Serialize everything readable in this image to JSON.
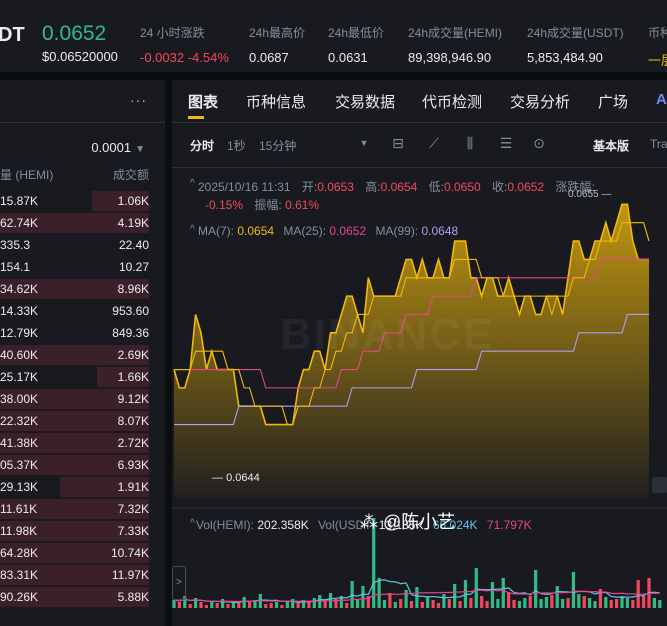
{
  "header": {
    "pair_fragment": "DT",
    "price": "0.0652",
    "price_usd": "$0.06520000",
    "stats": [
      {
        "label": "24 小时涨跌",
        "value": "-0.0032 -4.54%",
        "tone": "red"
      },
      {
        "label": "24h最高价",
        "value": "0.0687",
        "tone": ""
      },
      {
        "label": "24h最低价",
        "value": "0.0631",
        "tone": ""
      },
      {
        "label": "24h成交量(HEMI)",
        "value": "89,398,946.90",
        "tone": ""
      },
      {
        "label": "24h成交量(USDT)",
        "value": "5,853,484.90",
        "tone": ""
      },
      {
        "label": "币种",
        "value": "一层",
        "tone": "gold"
      }
    ]
  },
  "book": {
    "more_icon": "more-dots-icon",
    "precision": "0.0001",
    "col_amount": "量 (HEMI)",
    "col_total": "成交额",
    "rows": [
      {
        "amount": "15.87K",
        "total": "1.06K",
        "depth": 0.38
      },
      {
        "amount": "62.74K",
        "total": "4.19K",
        "depth": 1.0
      },
      {
        "amount": "335.3",
        "total": "22.40",
        "depth": 0.0
      },
      {
        "amount": "154.1",
        "total": "10.27",
        "depth": 0.0
      },
      {
        "amount": "34.62K",
        "total": "8.96K",
        "depth": 1.0
      },
      {
        "amount": "14.33K",
        "total": "953.60",
        "depth": 0.0
      },
      {
        "amount": "12.79K",
        "total": "849.36",
        "depth": 0.0
      },
      {
        "amount": "40.60K",
        "total": "2.69K",
        "depth": 1.0
      },
      {
        "amount": "25.17K",
        "total": "1.66K",
        "depth": 0.35
      },
      {
        "amount": "38.00K",
        "total": "9.12K",
        "depth": 1.0
      },
      {
        "amount": "22.32K",
        "total": "8.07K",
        "depth": 1.0
      },
      {
        "amount": "41.38K",
        "total": "2.72K",
        "depth": 1.0
      },
      {
        "amount": "05.37K",
        "total": "6.93K",
        "depth": 1.0
      },
      {
        "amount": "29.13K",
        "total": "1.91K",
        "depth": 0.6
      },
      {
        "amount": "11.61K",
        "total": "7.32K",
        "depth": 1.0
      },
      {
        "amount": "11.98K",
        "total": "7.33K",
        "depth": 1.0
      },
      {
        "amount": "64.28K",
        "total": "10.74K",
        "depth": 1.0
      },
      {
        "amount": "83.31K",
        "total": "11.97K",
        "depth": 1.0
      },
      {
        "amount": "90.26K",
        "total": "5.88K",
        "depth": 1.0
      }
    ]
  },
  "panel": {
    "tabs": [
      "图表",
      "币种信息",
      "交易数据",
      "代币检测",
      "交易分析",
      "广场"
    ],
    "tab_more": "A",
    "intervals": [
      "分时",
      "1秒",
      "15分钟"
    ],
    "version": "基本版",
    "version_more": "Tra",
    "tool_icons": [
      "dropdown-icon",
      "indicator-icon",
      "draw-icon",
      "candle-type-icon",
      "settings-icon",
      "target-icon"
    ]
  },
  "ohlc": {
    "datetime": "2025/10/16 11:31",
    "open_label": "开:",
    "open": "0.0653",
    "high_label": "高:",
    "high": "0.0654",
    "low_label": "低:",
    "low": "0.0650",
    "close_label": "收:",
    "close": "0.0652",
    "change_label": "涨跌幅:",
    "change": "-0.15%",
    "amp_label": "振幅:",
    "amp": "0.61%"
  },
  "ma": {
    "ma7_label": "MA(7):",
    "ma7": "0.0654",
    "ma25_label": "MA(25):",
    "ma25": "0.0652",
    "ma99_label": "MA(99):",
    "ma99": "0.0648"
  },
  "volume": {
    "hemi_label": "Vol(HEMI):",
    "hemi": "202.358K",
    "usdt_label": "Vol(USDT)",
    "usdt": "13.185K",
    "ma_a": "66.024K",
    "ma_b": "71.797K"
  },
  "marks": {
    "high": "0.0655",
    "low": "0.0644"
  },
  "watermark_text": "BINANCE",
  "user_watermark": "⁂ @陈小艺",
  "colors": {
    "up": "#2ebd85",
    "down": "#f6465d",
    "gold": "#f0b90b",
    "ma25": "#e5468b",
    "ma99": "#b49af0"
  },
  "chart_data": {
    "type": "area",
    "y_range": [
      0.064,
      0.0657
    ],
    "price": [
      0.0647,
      0.0646,
      0.0646,
      0.0647,
      0.065,
      0.0649,
      0.0647,
      0.0648,
      0.0647,
      0.0647,
      0.0647,
      0.0647,
      0.0645,
      0.0645,
      0.0645,
      0.0645,
      0.0645,
      0.0644,
      0.0644,
      0.0644,
      0.0644,
      0.0644,
      0.0644,
      0.0646,
      0.0647,
      0.0647,
      0.0648,
      0.0648,
      0.0647,
      0.0649,
      0.0649,
      0.065,
      0.0651,
      0.0651,
      0.065,
      0.0649,
      0.0652,
      0.0651,
      0.0651,
      0.0651,
      0.0651,
      0.0651,
      0.0652,
      0.0653,
      0.0653,
      0.0652,
      0.0653,
      0.0652,
      0.0652,
      0.0653,
      0.0652,
      0.0652,
      0.0654,
      0.0654,
      0.0654,
      0.0652,
      0.0652,
      0.0651,
      0.0652,
      0.0652,
      0.0651,
      0.0651,
      0.0652,
      0.0651,
      0.065,
      0.0651,
      0.0651,
      0.065,
      0.065,
      0.0651,
      0.0651,
      0.0651,
      0.065,
      0.0652,
      0.0654,
      0.0654,
      0.0653,
      0.0653,
      0.0654,
      0.0654,
      0.0655,
      0.0654,
      0.0655,
      0.0656,
      0.0656,
      0.0654,
      0.0653,
      0.0653,
      0.0653
    ],
    "ma7": [
      0.0647,
      0.0647,
      0.0647,
      0.0647,
      0.0648,
      0.0648,
      0.0648,
      0.0648,
      0.0648,
      0.0648,
      0.0647,
      0.0647,
      0.0647,
      0.0646,
      0.0646,
      0.0645,
      0.0645,
      0.0645,
      0.0645,
      0.0645,
      0.0645,
      0.0644,
      0.0644,
      0.0645,
      0.0645,
      0.0645,
      0.0646,
      0.0646,
      0.0647,
      0.0647,
      0.0648,
      0.0648,
      0.0649,
      0.0649,
      0.065,
      0.065,
      0.065,
      0.0651,
      0.0651,
      0.0651,
      0.0651,
      0.0651,
      0.0651,
      0.0652,
      0.0652,
      0.0652,
      0.0652,
      0.0652,
      0.0652,
      0.0652,
      0.0652,
      0.0652,
      0.0653,
      0.0653,
      0.0653,
      0.0653,
      0.0653,
      0.0652,
      0.0652,
      0.0652,
      0.0652,
      0.0651,
      0.0651,
      0.0651,
      0.0651,
      0.0651,
      0.0651,
      0.0651,
      0.0651,
      0.0651,
      0.065,
      0.0651,
      0.0651,
      0.0651,
      0.0652,
      0.0652,
      0.0652,
      0.0653,
      0.0653,
      0.0654,
      0.0654,
      0.0654,
      0.0654,
      0.0655,
      0.0655,
      0.0655,
      0.0655,
      0.0655,
      0.0654
    ],
    "ma25": [
      0.0647,
      0.0647,
      0.0647,
      0.0647,
      0.0647,
      0.0647,
      0.0647,
      0.0647,
      0.0647,
      0.0647,
      0.0647,
      0.0647,
      0.0647,
      0.0647,
      0.0647,
      0.0647,
      0.0647,
      0.0646,
      0.0646,
      0.0646,
      0.0646,
      0.0646,
      0.0646,
      0.0646,
      0.0646,
      0.0646,
      0.0646,
      0.0646,
      0.0646,
      0.0646,
      0.0646,
      0.0647,
      0.0647,
      0.0647,
      0.0647,
      0.0648,
      0.0648,
      0.0648,
      0.0648,
      0.0649,
      0.0649,
      0.0649,
      0.0649,
      0.065,
      0.065,
      0.065,
      0.065,
      0.065,
      0.0651,
      0.0651,
      0.0651,
      0.0651,
      0.0651,
      0.0651,
      0.0651,
      0.0651,
      0.0652,
      0.0652,
      0.0652,
      0.0652,
      0.0652,
      0.0652,
      0.0652,
      0.0652,
      0.0652,
      0.0652,
      0.0652,
      0.0652,
      0.0652,
      0.0652,
      0.0652,
      0.0652,
      0.0652,
      0.0652,
      0.0652,
      0.0652,
      0.0652,
      0.0652,
      0.0652,
      0.0653,
      0.0653,
      0.0653,
      0.0653,
      0.0653,
      0.0653,
      0.0653,
      0.0653,
      0.0653,
      0.0653
    ],
    "ma99": [
      0.0644,
      0.0644,
      0.0644,
      0.0644,
      0.0644,
      0.0644,
      0.0644,
      0.0644,
      0.0644,
      0.0644,
      0.0644,
      0.0644,
      0.0645,
      0.0645,
      0.0645,
      0.0645,
      0.0645,
      0.0645,
      0.0645,
      0.0645,
      0.0645,
      0.0645,
      0.0645,
      0.0645,
      0.0645,
      0.0645,
      0.0645,
      0.0645,
      0.0645,
      0.0645,
      0.0645,
      0.0645,
      0.0645,
      0.0646,
      0.0646,
      0.0646,
      0.0646,
      0.0646,
      0.0646,
      0.0646,
      0.0646,
      0.0646,
      0.0646,
      0.0646,
      0.0646,
      0.0647,
      0.0647,
      0.0647,
      0.0647,
      0.0647,
      0.0647,
      0.0647,
      0.0647,
      0.0647,
      0.0647,
      0.0647,
      0.0647,
      0.0648,
      0.0648,
      0.0648,
      0.0648,
      0.0648,
      0.0648,
      0.0648,
      0.0648,
      0.0648,
      0.0648,
      0.0648,
      0.0648,
      0.0648,
      0.0648,
      0.0648,
      0.0648,
      0.0648,
      0.0648,
      0.0649,
      0.0649,
      0.0649,
      0.0649,
      0.0649,
      0.0649,
      0.0649,
      0.0649,
      0.0649,
      0.065,
      0.065,
      0.065,
      0.065,
      0.065
    ],
    "volume": [
      8,
      6,
      12,
      4,
      10,
      6,
      3,
      6,
      5,
      9,
      4,
      7,
      5,
      11,
      6,
      8,
      14,
      4,
      5,
      6,
      3,
      7,
      9,
      5,
      8,
      6,
      10,
      13,
      7,
      15,
      9,
      12,
      5,
      27,
      8,
      22,
      12,
      90,
      30,
      8,
      15,
      6,
      9,
      18,
      7,
      21,
      6,
      11,
      8,
      5,
      14,
      9,
      24,
      7,
      28,
      10,
      40,
      12,
      7,
      26,
      9,
      30,
      16,
      8,
      7,
      10,
      12,
      38,
      9,
      11,
      13,
      22,
      9,
      10,
      36,
      14,
      12,
      10,
      7,
      19,
      11,
      8,
      9,
      12,
      10,
      8,
      28,
      12,
      30,
      10,
      8
    ],
    "volume_up": [
      1,
      0,
      1,
      0,
      1,
      0,
      0,
      1,
      0,
      1,
      0,
      1,
      0,
      1,
      0,
      1,
      1,
      0,
      0,
      1,
      0,
      1,
      1,
      0,
      1,
      0,
      1,
      1,
      0,
      1,
      0,
      1,
      0,
      1,
      1,
      1,
      0,
      1,
      1,
      1,
      0,
      1,
      0,
      1,
      0,
      1,
      0,
      1,
      0,
      0,
      1,
      0,
      1,
      0,
      1,
      0,
      1,
      0,
      0,
      1,
      1,
      1,
      0,
      0,
      1,
      1,
      0,
      1,
      1,
      1,
      0,
      1,
      1,
      0,
      1,
      1,
      0,
      1,
      1,
      0,
      1,
      0,
      0,
      1,
      1,
      0,
      0,
      0,
      0,
      1,
      1
    ]
  }
}
